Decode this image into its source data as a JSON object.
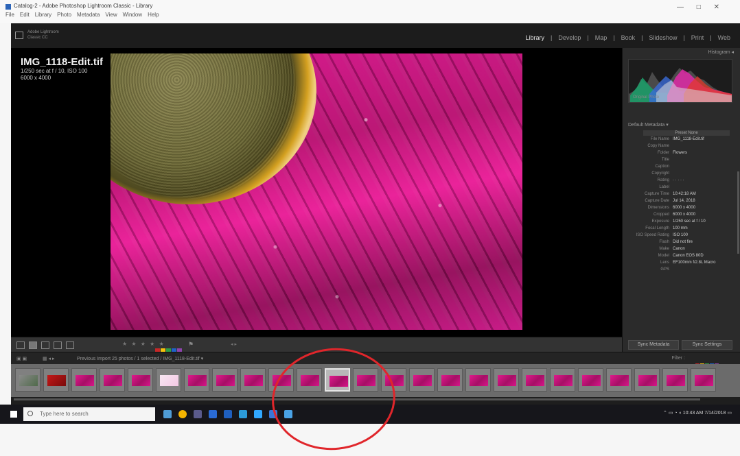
{
  "window": {
    "title": "Catalog-2 - Adobe Photoshop Lightroom Classic - Library",
    "menu": [
      "File",
      "Edit",
      "Library",
      "Photo",
      "Metadata",
      "View",
      "Window",
      "Help"
    ],
    "controls": "—  □  ✕"
  },
  "identity_plate": "Adobe Lightroom\nClassic CC",
  "modules": [
    "Library",
    "Develop",
    "Map",
    "Book",
    "Slideshow",
    "Print",
    "Web"
  ],
  "active_module": "Library",
  "photo_info": {
    "filename": "IMG_1118-Edit.tif",
    "line2": "1/250 sec at f / 10, ISO 100",
    "line3": "6000 x 4000"
  },
  "right_panel": {
    "histogram_header": "Histogram ◂",
    "histogram_caption": "Original Photo",
    "metadata_header": "Default    Metadata ▾",
    "preset_label": "Preset  None",
    "metadata": [
      [
        "File Name",
        "IMG_1118-Edit.tif"
      ],
      [
        "Copy Name",
        ""
      ],
      [
        "Folder",
        "Flowers"
      ],
      [
        "Title",
        ""
      ],
      [
        "Caption",
        ""
      ],
      [
        "Copyright",
        ""
      ],
      [
        "Rating",
        "· · · · ·"
      ],
      [
        "Label",
        ""
      ],
      [
        "Capture Time",
        "10:42:18 AM"
      ],
      [
        "Capture Date",
        "Jul 14, 2018"
      ],
      [
        "Dimensions",
        "6000 x 4000"
      ],
      [
        "Cropped",
        "6000 x 4000"
      ],
      [
        "Exposure",
        "1/250 sec at f / 10"
      ],
      [
        "Focal Length",
        "100 mm"
      ],
      [
        "ISO Speed Rating",
        "ISO 100"
      ],
      [
        "Flash",
        "Did not fire"
      ],
      [
        "Make",
        "Canon"
      ],
      [
        "Model",
        "Canon EOS 80D"
      ],
      [
        "Lens",
        "EF100mm f/2.8L Macro"
      ],
      [
        "GPS",
        ""
      ]
    ],
    "sync_metadata": "Sync Metadata",
    "sync_settings": "Sync Settings"
  },
  "toolbar": {
    "rating": "★ ★ ★ ★ ★",
    "color_labels": [
      "#c62828",
      "#f4c20d",
      "#2e9e44",
      "#1e63c9",
      "#8e44ad"
    ],
    "flag": "⚑",
    "context": "◂ ▸"
  },
  "filmstrip": {
    "breadcrumb": "Previous Import    25 photos / 1 selected / IMG_1118-Edit.tif ▾",
    "filter": "Filter :",
    "thumbnails": [
      "gray",
      "red",
      "pink",
      "pink",
      "pink",
      "pale",
      "pink",
      "pink",
      "pink",
      "pink",
      "pink",
      "pink",
      "pink",
      "pink",
      "pink",
      "pink",
      "pink",
      "pink",
      "pink",
      "pink",
      "pink",
      "pink",
      "pink",
      "pink",
      "pink"
    ],
    "selected_index": 11
  },
  "taskbar": {
    "search_placeholder": "Type here to search",
    "icons": [
      "#4f9cd6",
      "#f4b400",
      "#5a5a8c",
      "#2a6bd6",
      "#1f5fbf",
      "#2c9bd9",
      "#31a8ff",
      "#3a76d6",
      "#4aa3e6"
    ],
    "clock_time": "10:43 AM",
    "clock_date": "7/14/2018"
  },
  "colors": {
    "annotation": "#e0262b",
    "lightroom_bg": "#1e1e1e",
    "photo_magenta": "#d4148a"
  }
}
